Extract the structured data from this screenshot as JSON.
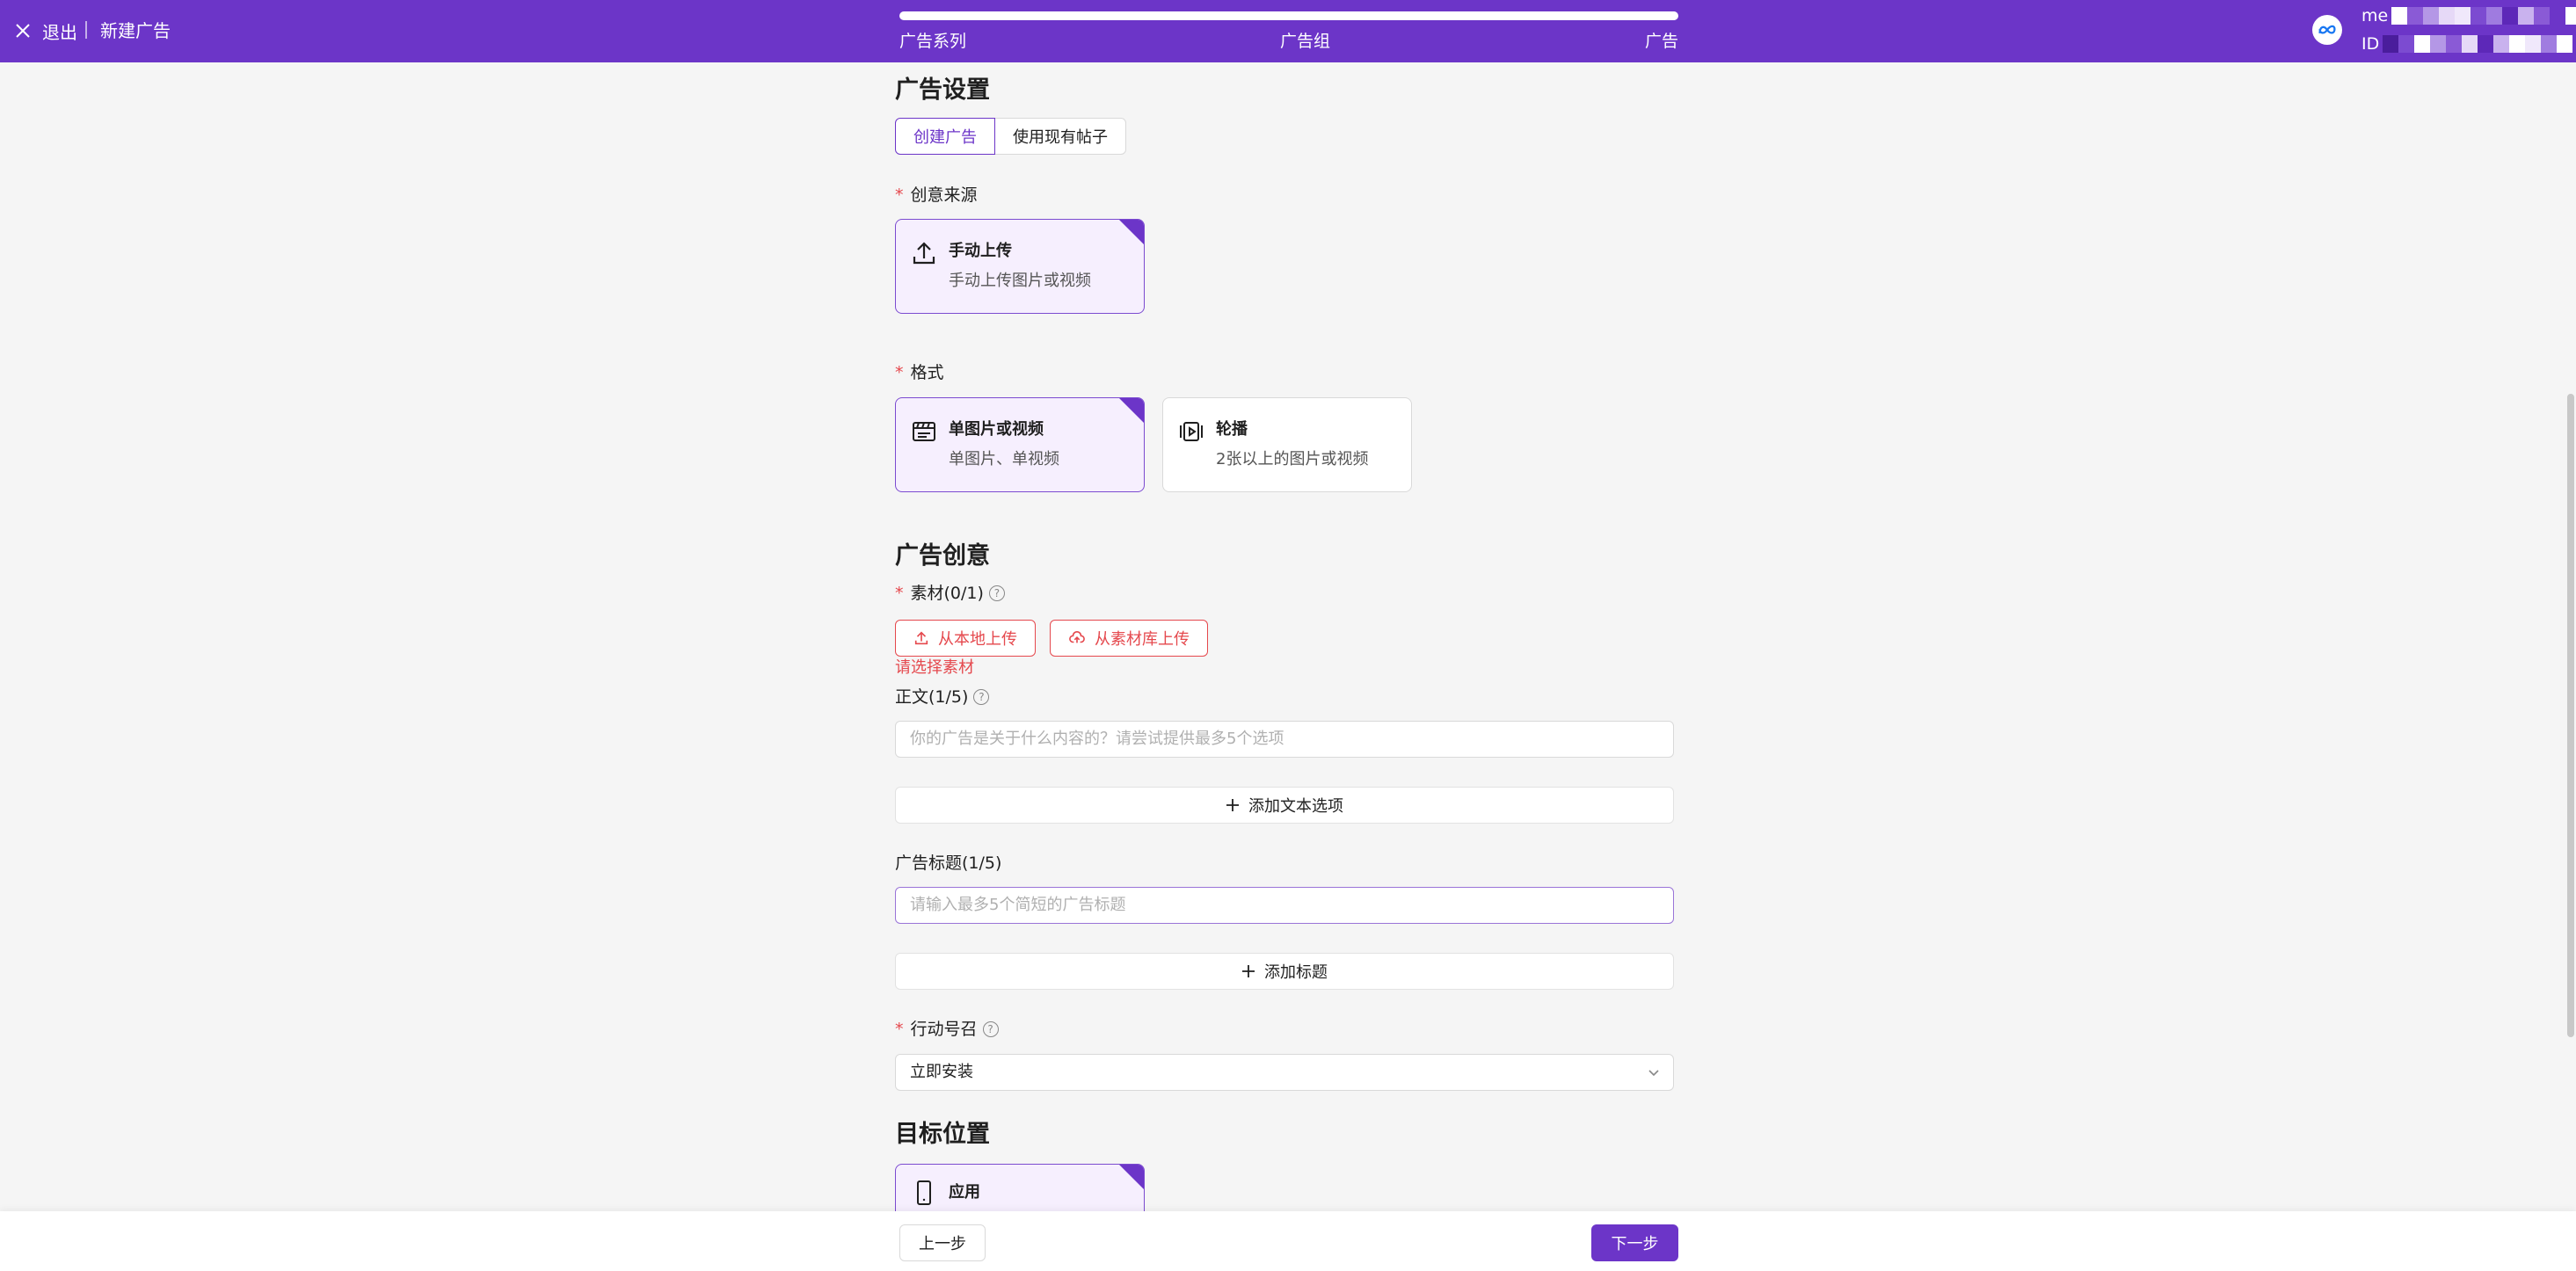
{
  "header": {
    "exit_label": "退出",
    "page_title": "新建广告",
    "steps": [
      "广告系列",
      "广告组",
      "广告"
    ],
    "account_name_prefix": "me",
    "account_id_prefix": "ID"
  },
  "ad_settings": {
    "title": "广告设置",
    "tabs": [
      "创建广告",
      "使用现有帖子"
    ],
    "creative_source": {
      "label": "创意来源",
      "options": [
        {
          "title": "手动上传",
          "desc": "手动上传图片或视频",
          "icon": "upload-icon",
          "selected": true
        }
      ]
    },
    "format": {
      "label": "格式",
      "options": [
        {
          "title": "单图片或视频",
          "desc": "单图片、单视频",
          "icon": "image-video-icon",
          "selected": true
        },
        {
          "title": "轮播",
          "desc": "2张以上的图片或视频",
          "icon": "carousel-icon",
          "selected": false
        }
      ]
    }
  },
  "ad_creative": {
    "title": "广告创意",
    "material": {
      "label": "素材(0/1)",
      "upload_local": "从本地上传",
      "upload_library": "从素材库上传",
      "error": "请选择素材"
    },
    "body_text": {
      "label": "正文(1/5)",
      "placeholder": "你的广告是关于什么内容的？请尝试提供最多5个选项",
      "add_button": "添加文本选项"
    },
    "headline": {
      "label": "广告标题(1/5)",
      "placeholder": "请输入最多5个简短的广告标题",
      "add_button": "添加标题"
    },
    "cta": {
      "label": "行动号召",
      "value": "立即安装"
    }
  },
  "destination": {
    "title": "目标位置",
    "option_title": "应用"
  },
  "footer": {
    "prev": "上一步",
    "next": "下一步"
  },
  "colors": {
    "brand": "#6c35c8",
    "error": "#e5484d",
    "selected_bg": "#f6effe"
  }
}
